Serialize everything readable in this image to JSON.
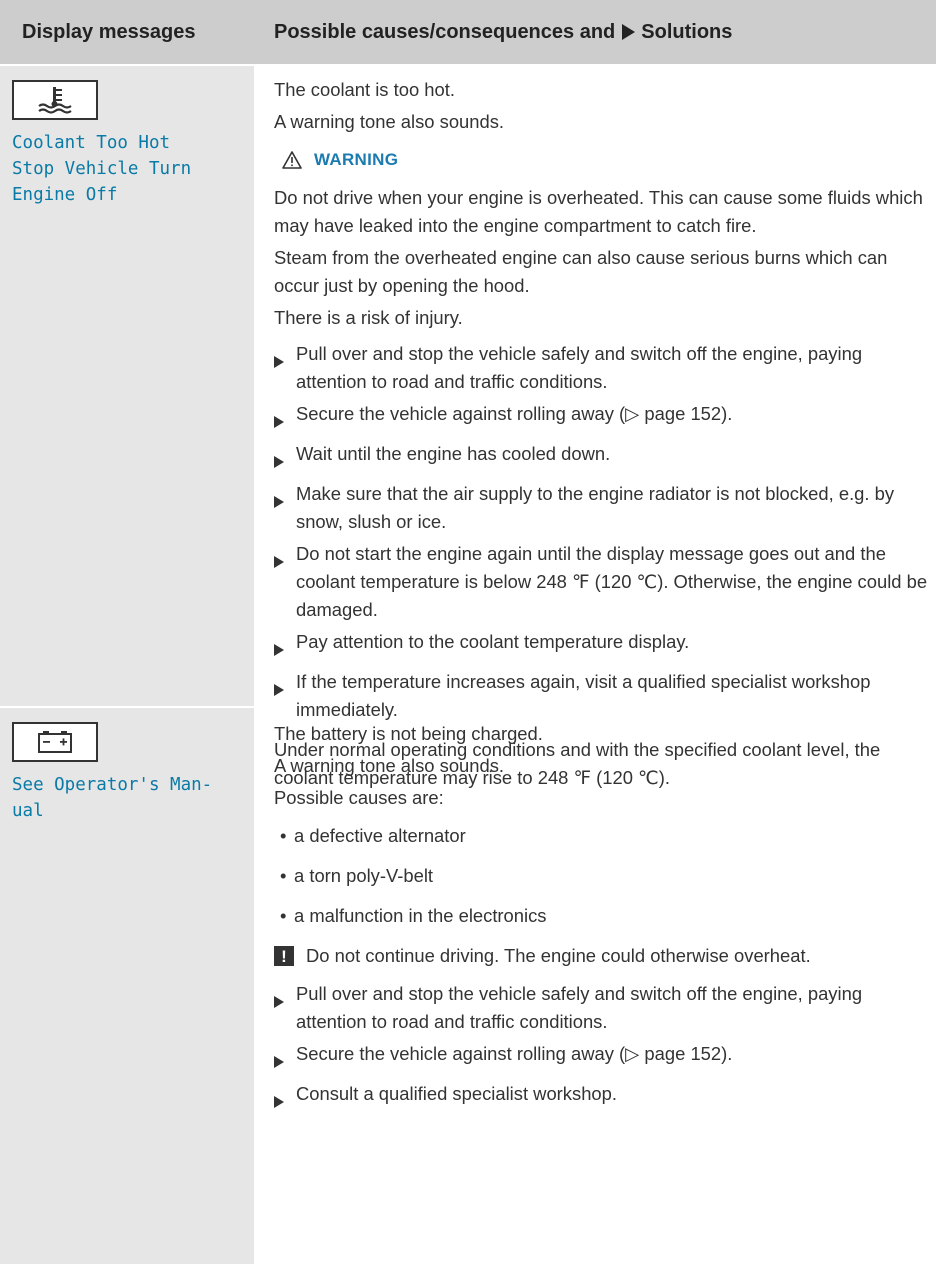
{
  "header": {
    "col1": "Display messages",
    "col2_prefix": "Possible causes/consequences and",
    "col2_suffix": "Solutions"
  },
  "rows": [
    {
      "icon": "coolant-temperature-icon",
      "message": "Coolant Too Hot\nStop Vehicle Turn\nEngine Off",
      "intro": [
        "The coolant is too hot.",
        "A warning tone also sounds."
      ],
      "warning_label": "WARNING",
      "warning_paragraphs": [
        "Do not drive when your engine is overheated. This can cause some fluids which may have leaked into the engine compartment to catch fire.",
        "Steam from the overheated engine can also cause serious burns which can occur just by opening the hood.",
        "There is a risk of injury."
      ],
      "steps": [
        "Pull over and stop the vehicle safely and switch off the engine, paying attention to road and traffic conditions.",
        "Secure the vehicle against rolling away (▷ page 152).",
        "Wait until the engine has cooled down.",
        "Make sure that the air supply to the engine radiator is not blocked, e.g. by snow, slush or ice.",
        "Do not start the engine again until the display message goes out and the coolant temperature is below 248 ℉ (120 ℃). Otherwise, the engine could be damaged.",
        "Pay attention to the coolant temperature display.",
        "If the temperature increases again, visit a qualified specialist workshop immediately."
      ],
      "footer": "Under normal operating conditions and with the specified coolant level, the coolant temperature may rise to 248 ℉ (120 ℃)."
    },
    {
      "icon": "battery-icon",
      "message": "See Operator's Man-\nual",
      "intro": [
        "The battery is not being charged.",
        "A warning tone also sounds.",
        "Possible causes are:"
      ],
      "causes": [
        "a defective alternator",
        "a torn poly-V-belt",
        "a malfunction in the electronics"
      ],
      "note": "Do not continue driving. The engine could otherwise overheat.",
      "steps": [
        "Pull over and stop the vehicle safely and switch off the engine, paying attention to road and traffic conditions.",
        "Secure the vehicle against rolling away (▷ page 152).",
        "Consult a qualified specialist workshop."
      ]
    }
  ]
}
